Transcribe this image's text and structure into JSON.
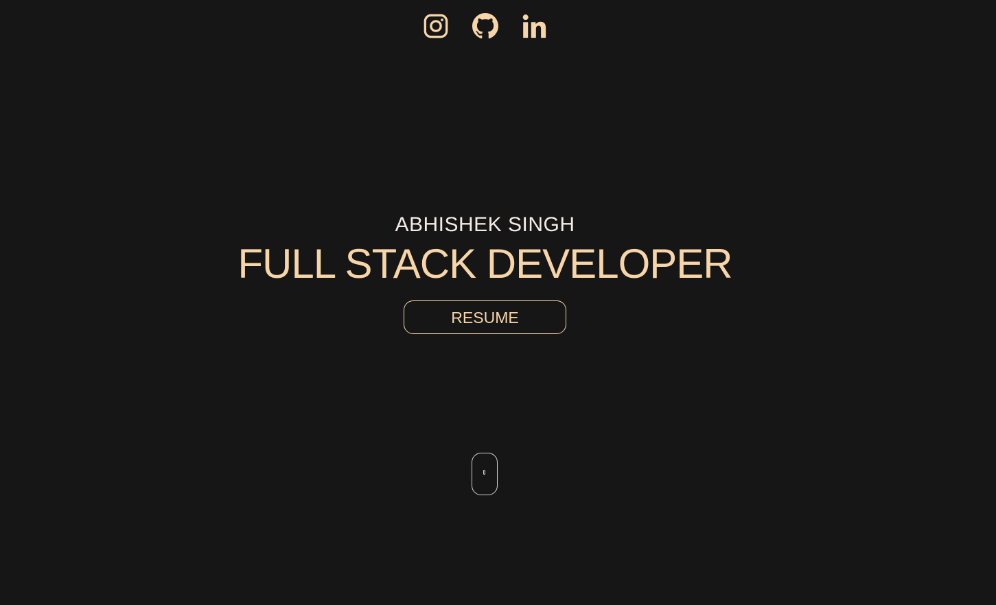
{
  "social": {
    "items": [
      {
        "icon": "instagram-icon"
      },
      {
        "icon": "github-icon"
      },
      {
        "icon": "linkedin-icon"
      }
    ]
  },
  "hero": {
    "name": "ABHISHEK SINGH",
    "role": "FULL STACK DEVELOPER",
    "resume_label": "RESUME"
  },
  "colors": {
    "background": "#161616",
    "accent": "#f7d5a8",
    "text": "#f3ece4"
  }
}
